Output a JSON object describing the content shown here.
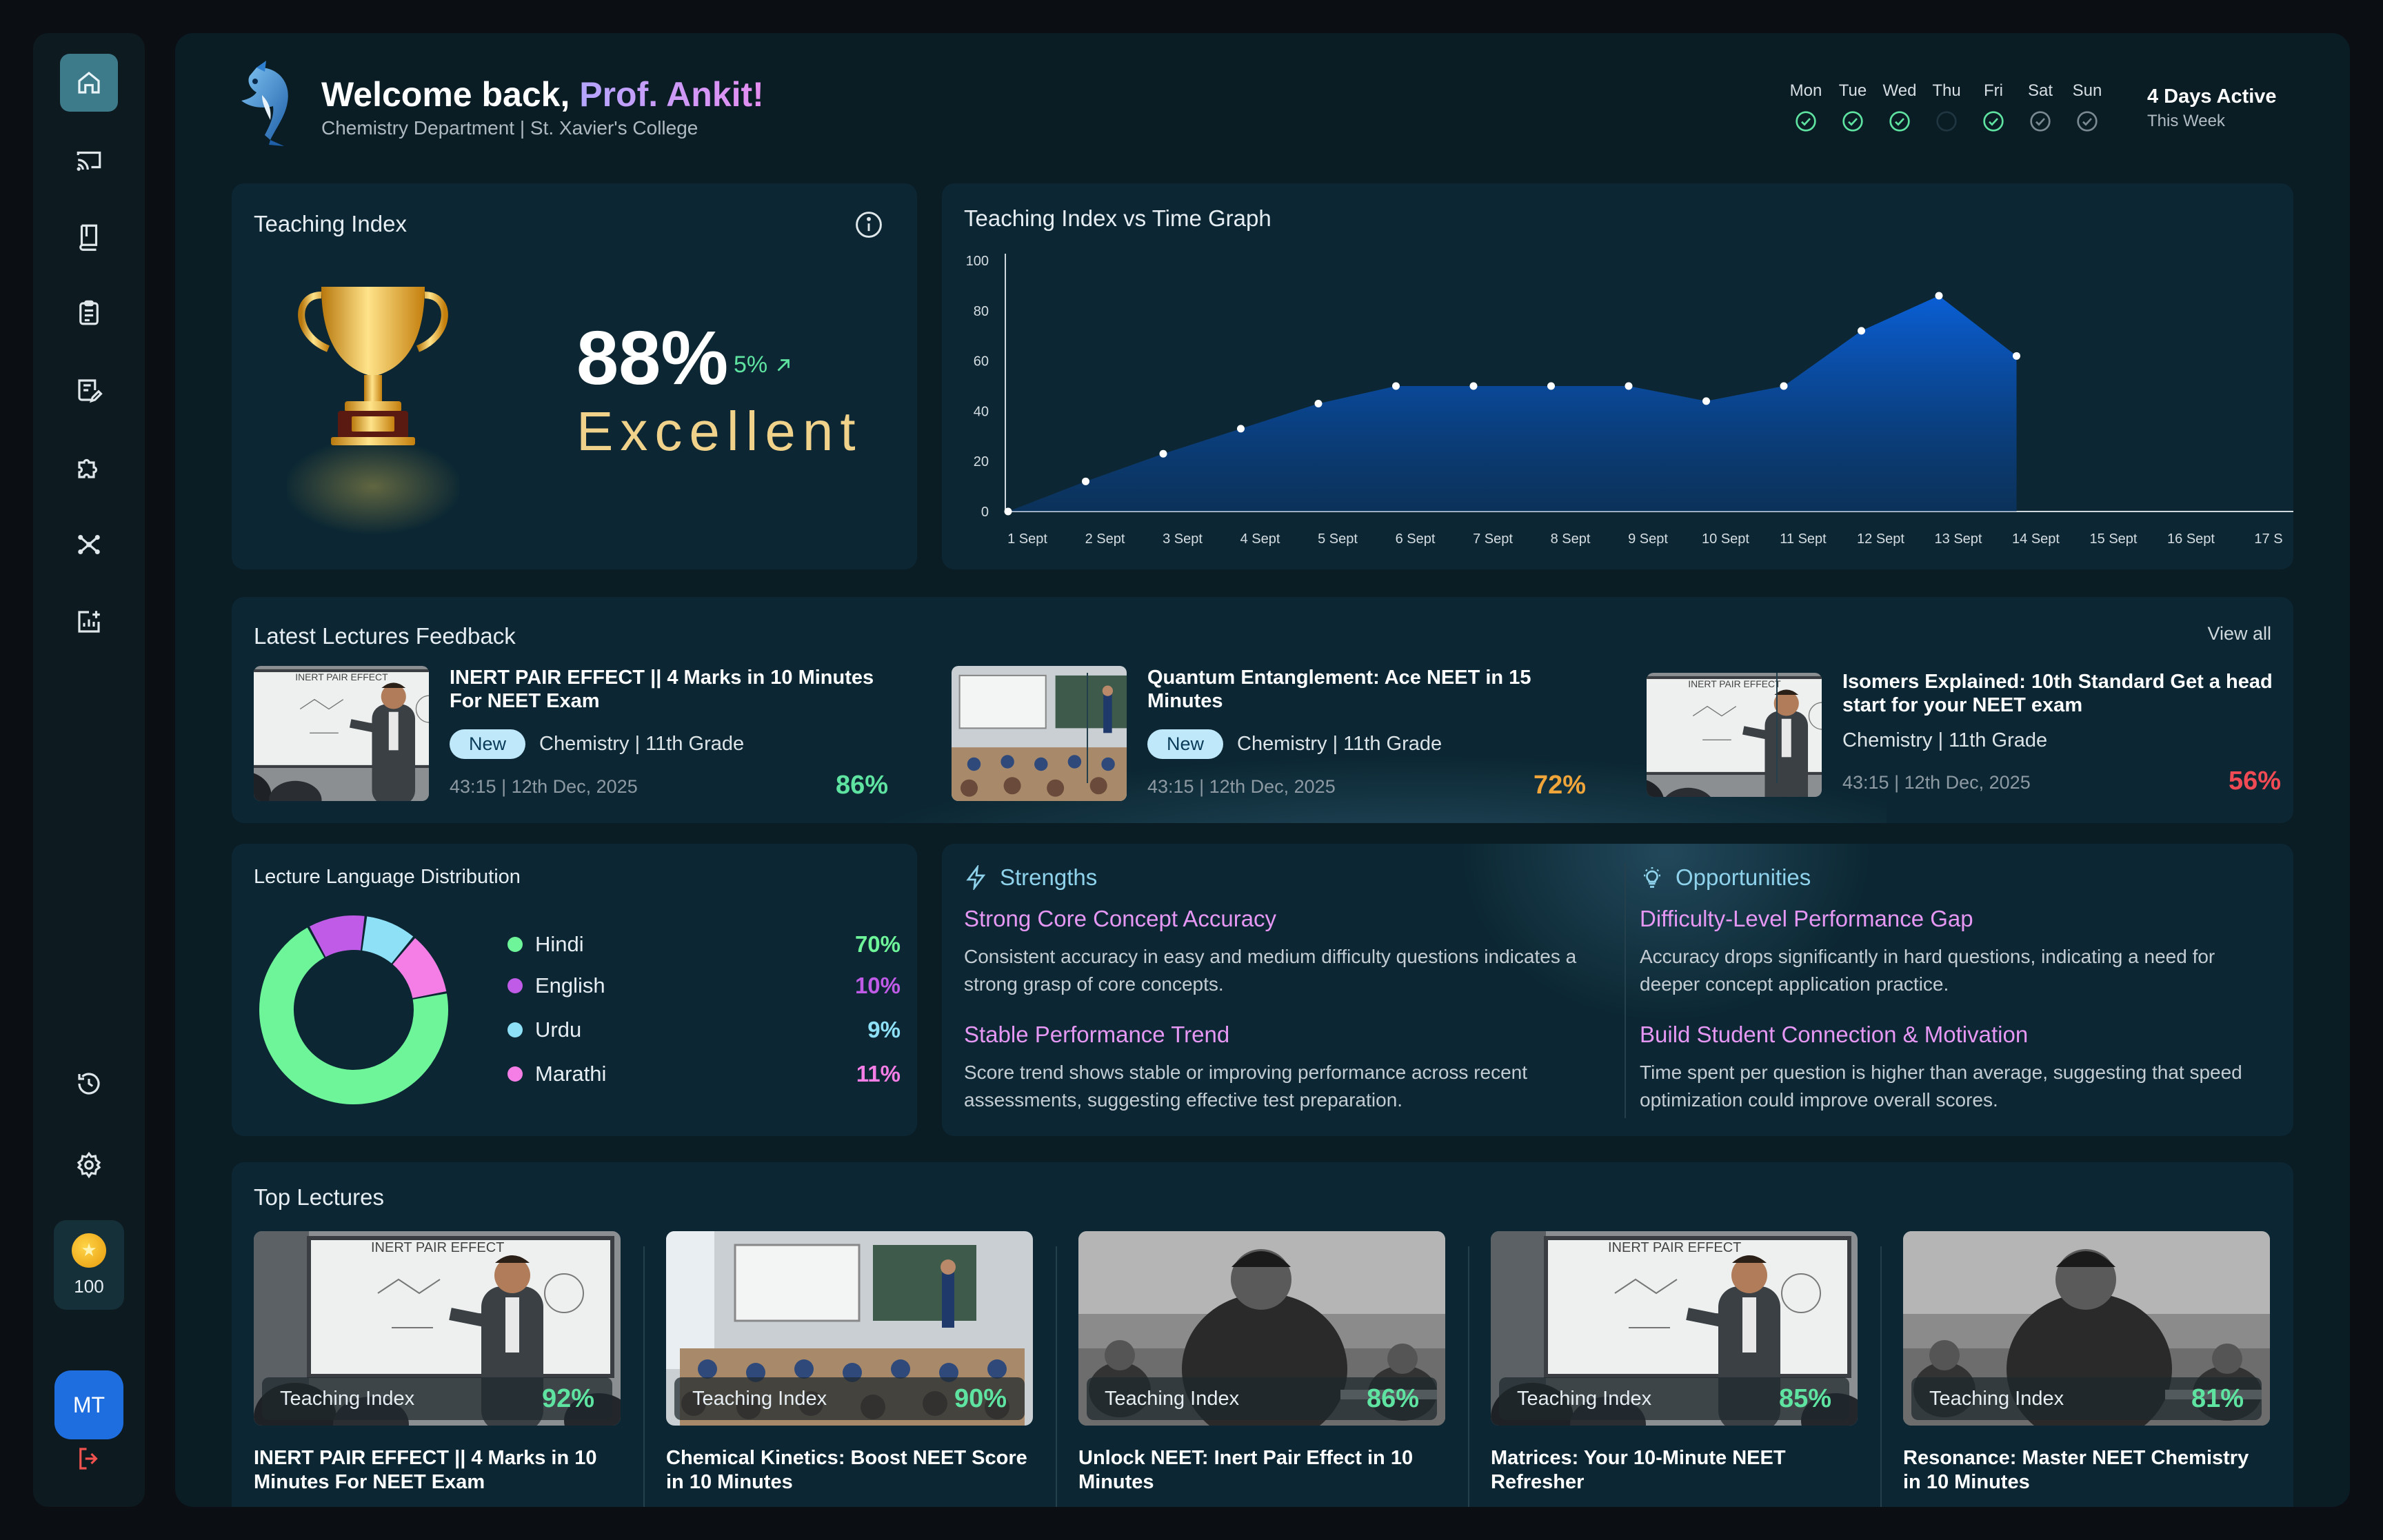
{
  "header": {
    "greeting": "Welcome back, ",
    "name": "Prof. Ankit!",
    "department": "Chemistry Department | St. Xavier's College",
    "week": [
      {
        "label": "Mon",
        "done": true
      },
      {
        "label": "Tue",
        "done": true
      },
      {
        "label": "Wed",
        "done": true
      },
      {
        "label": "Thu",
        "done": false
      },
      {
        "label": "Fri",
        "done": true
      },
      {
        "label": "Sat",
        "done": "muted"
      },
      {
        "label": "Sun",
        "done": "muted"
      }
    ],
    "active_title": "4 Days Active",
    "active_sub": "This Week"
  },
  "sidebar": {
    "icons": [
      "home-icon",
      "cast-icon",
      "book-icon",
      "clipboard-icon",
      "edit-document-icon",
      "puzzle-icon",
      "network-icon",
      "analytics-icon",
      "history-icon",
      "settings-icon"
    ],
    "coins": "100",
    "avatar": "MT",
    "logout_icon": "logout-icon"
  },
  "teaching_index": {
    "title": "Teaching Index",
    "percent": "88%",
    "delta": "5%",
    "rating": "Excellent"
  },
  "chart_data": {
    "type": "area",
    "title": "Teaching Index vs Time Graph",
    "categories": [
      "1 Sept",
      "2 Sept",
      "3 Sept",
      "4 Sept",
      "5 Sept",
      "6 Sept",
      "7 Sept",
      "8 Sept",
      "9 Sept",
      "10 Sept",
      "11 Sept",
      "12 Sept",
      "13 Sept",
      "14 Sept",
      "15 Sept",
      "16 Sept",
      "17 S"
    ],
    "values": [
      0,
      12,
      23,
      33,
      43,
      50,
      50,
      50,
      50,
      44,
      50,
      72,
      86,
      62,
      null,
      null,
      null
    ],
    "ylim": [
      0,
      100
    ],
    "yticks": [
      0,
      20,
      40,
      60,
      80,
      100
    ],
    "color": "#0a5fd6"
  },
  "feedback": {
    "title": "Latest Lectures Feedback",
    "view_all": "View all",
    "items": [
      {
        "title": "INERT PAIR EFFECT || 4 Marks in 10 Minutes For NEET Exam",
        "badge": "New",
        "meta": "Chemistry | 11th Grade",
        "time": "43:15  | 12th Dec, 2025",
        "score": "86%",
        "color": "#5ee3a1"
      },
      {
        "title": "Quantum Entanglement: Ace NEET in 15 Minutes",
        "badge": "New",
        "meta": "Chemistry | 11th Grade",
        "time": "43:15  | 12th Dec, 2025",
        "score": "72%",
        "color": "#f0a53a"
      },
      {
        "title": "Isomers Explained: 10th Standard Get a head start for your NEET exam",
        "badge": "",
        "meta": "Chemistry | 11th Grade",
        "time": "43:15  | 12th Dec, 2025",
        "score": "56%",
        "color": "#f04a55"
      }
    ]
  },
  "language": {
    "title": "Lecture Language Distribution",
    "items": [
      {
        "name": "Hindi",
        "value": "70%",
        "pct": 70,
        "color": "#6ef59a"
      },
      {
        "name": "English",
        "value": "10%",
        "pct": 10,
        "color": "#bf5be6"
      },
      {
        "name": "Urdu",
        "value": "9%",
        "pct": 9,
        "color": "#8ee0f7"
      },
      {
        "name": "Marathi",
        "value": "11%",
        "pct": 11,
        "color": "#f47ee6"
      }
    ]
  },
  "strengths": {
    "title": "Strengths",
    "items": [
      {
        "heading": "Strong Core Concept Accuracy",
        "body": "Consistent accuracy in easy and medium difficulty questions indicates a strong grasp of core concepts."
      },
      {
        "heading": "Stable Performance Trend",
        "body": "Score trend shows stable or improving performance across recent assessments, suggesting effective test preparation."
      }
    ]
  },
  "opportunities": {
    "title": "Opportunities",
    "items": [
      {
        "heading": "Difficulty-Level Performance Gap",
        "body": "Accuracy drops significantly in hard questions, indicating a need for deeper concept application practice."
      },
      {
        "heading": "Build Student Connection & Motivation",
        "body": "Time spent per question is higher than average, suggesting that speed optimization could improve overall scores."
      }
    ]
  },
  "top_lectures": {
    "title": "Top Lectures",
    "label": "Teaching Index",
    "items": [
      {
        "title": "INERT PAIR EFFECT || 4 Marks in 10 Minutes For NEET Exam",
        "score": "92%"
      },
      {
        "title": "Chemical Kinetics: Boost NEET Score in 10 Minutes",
        "score": "90%"
      },
      {
        "title": "Unlock NEET: Inert Pair Effect in 10 Minutes",
        "score": "86%"
      },
      {
        "title": "Matrices: Your 10-Minute NEET Refresher",
        "score": "85%"
      },
      {
        "title": "Resonance: Master NEET Chemistry in 10 Minutes",
        "score": "81%"
      }
    ],
    "board_text": "INERT PAIR EFFECT"
  }
}
